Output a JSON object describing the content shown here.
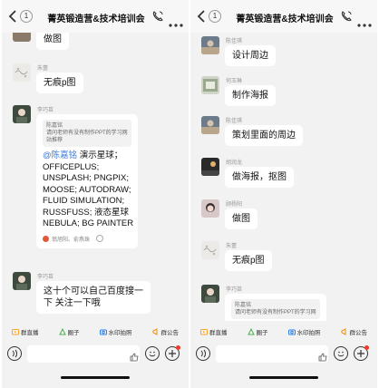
{
  "header": {
    "title": "菁英锻造营&技术培训会",
    "unread_count": "1"
  },
  "left": {
    "messages": [
      {
        "text": "做图"
      },
      {
        "sender": "朱蕾",
        "text": "无痕p图"
      },
      {
        "sender": "李巧苗",
        "quote_name": "陈嘉铭",
        "quote_text_1": "请问老师有没有制作PPT的学习网",
        "quote_text_2": "站推荐",
        "mention": "@陈嘉铭",
        "line_1": " 演示星球；",
        "line_2": "OFFICEPLUS;",
        "line_3": "UNSPLASH; PNGPIX;",
        "line_4": "MOOSE; AUTODRAW;",
        "line_5": "FLUID SIMULATION;",
        "line_6": "RUSSFUSS; 液态星球",
        "line_7": "NEBULA; BG PAINTER",
        "reads": "翁旭阳、俞燕珠"
      },
      {
        "sender": "李巧苗",
        "line_1": "这十个可以自己百度搜一",
        "line_2": "下 关注一下哦"
      }
    ]
  },
  "right": {
    "messages": [
      {
        "sender": "陈佳琪",
        "text": "设计周边"
      },
      {
        "sender": "何玉琳",
        "text": "制作海报"
      },
      {
        "sender": "陈佳琪",
        "text": "策划里面的周边"
      },
      {
        "sender": "胡润龙",
        "text": "做海报，抠图"
      },
      {
        "sender": "顾杨阳",
        "text": "做图"
      },
      {
        "sender": "朱蕾",
        "text": "无痕p图"
      },
      {
        "sender": "李巧苗",
        "quote_name": "陈嘉铭",
        "quote_text_1": "请问老师有没有制作PPT的学习网"
      }
    ]
  },
  "toolbar": {
    "live": "群直播",
    "circle": "圈子",
    "camera": "水印拍照",
    "notice": "群公告"
  },
  "colors": {
    "mention": "#3a7be0",
    "live": "#f5a623",
    "circle": "#4caf50",
    "camera": "#2f80ed",
    "notice": "#f08c00"
  }
}
